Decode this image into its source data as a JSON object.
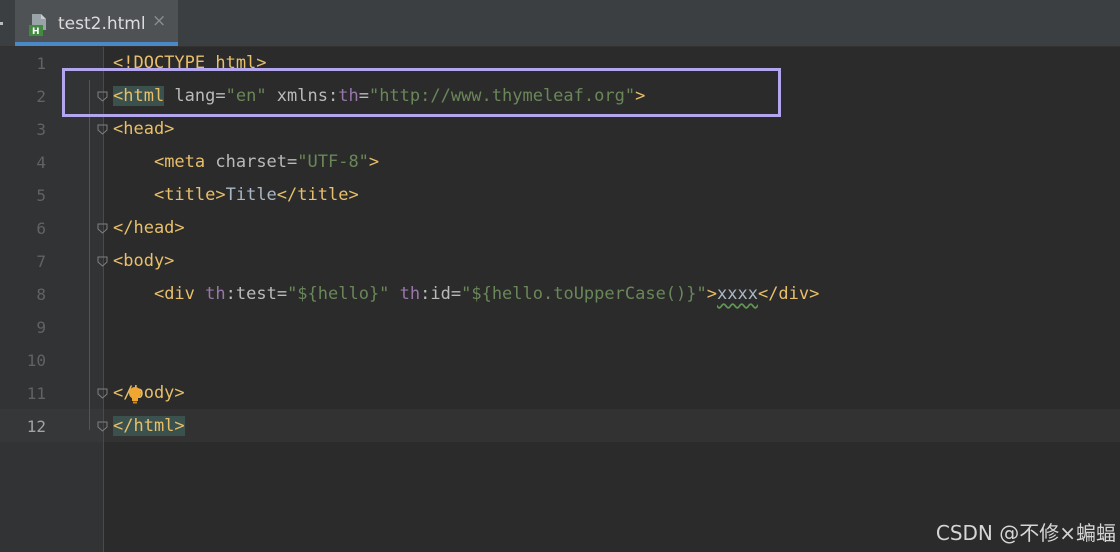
{
  "tab": {
    "file_name": "test2.html",
    "close_glyph": "×",
    "icon": "html-file-icon"
  },
  "editor": {
    "current_line": 12,
    "lines": [
      {
        "num": "1",
        "segs": [
          [
            "tag",
            "<!DOCTYPE html>"
          ]
        ]
      },
      {
        "num": "2",
        "segs": [
          [
            "hltag",
            "<html"
          ],
          [
            "attr",
            " lang="
          ],
          [
            "val",
            "\"en\""
          ],
          [
            "attr",
            " xmlns:"
          ],
          [
            "ns",
            "th"
          ],
          [
            "attr",
            "="
          ],
          [
            "val",
            "\"http://www.thymeleaf.org\""
          ],
          [
            "tag",
            ">"
          ]
        ]
      },
      {
        "num": "3",
        "segs": [
          [
            "tag",
            "<head>"
          ]
        ]
      },
      {
        "num": "4",
        "segs": [
          [
            "txt",
            "    "
          ],
          [
            "tag",
            "<meta"
          ],
          [
            "attr",
            " charset="
          ],
          [
            "val",
            "\"UTF-8\""
          ],
          [
            "tag",
            ">"
          ]
        ]
      },
      {
        "num": "5",
        "segs": [
          [
            "txt",
            "    "
          ],
          [
            "tag",
            "<title>"
          ],
          [
            "txt",
            "Title"
          ],
          [
            "tag",
            "</title>"
          ]
        ]
      },
      {
        "num": "6",
        "segs": [
          [
            "tag",
            "</head>"
          ]
        ]
      },
      {
        "num": "7",
        "segs": [
          [
            "tag",
            "<body>"
          ]
        ]
      },
      {
        "num": "8",
        "segs": [
          [
            "txt",
            "    "
          ],
          [
            "tag",
            "<div"
          ],
          [
            "attr",
            " "
          ],
          [
            "ns",
            "th"
          ],
          [
            "attr",
            ":test="
          ],
          [
            "val",
            "\"${hello}\""
          ],
          [
            "attr",
            " "
          ],
          [
            "ns",
            "th"
          ],
          [
            "attr",
            ":id="
          ],
          [
            "val",
            "\"${hello.toUpperCase()}\""
          ],
          [
            "tag",
            ">"
          ],
          [
            "squig",
            "xxxx"
          ],
          [
            "tag",
            "</div>"
          ]
        ]
      },
      {
        "num": "9",
        "segs": []
      },
      {
        "num": "10",
        "segs": []
      },
      {
        "num": "11",
        "segs": [
          [
            "tag",
            "</body>"
          ]
        ]
      },
      {
        "num": "12",
        "segs": [
          [
            "hltag",
            "</html>"
          ]
        ]
      }
    ]
  },
  "watermark": "CSDN @不修×蝙蝠",
  "colors": {
    "highlight_box": "#b4a5ef",
    "tag": "#e8bf6a",
    "string": "#6a8759",
    "namespace": "#9876aa",
    "tab_underline": "#4a88c7"
  }
}
